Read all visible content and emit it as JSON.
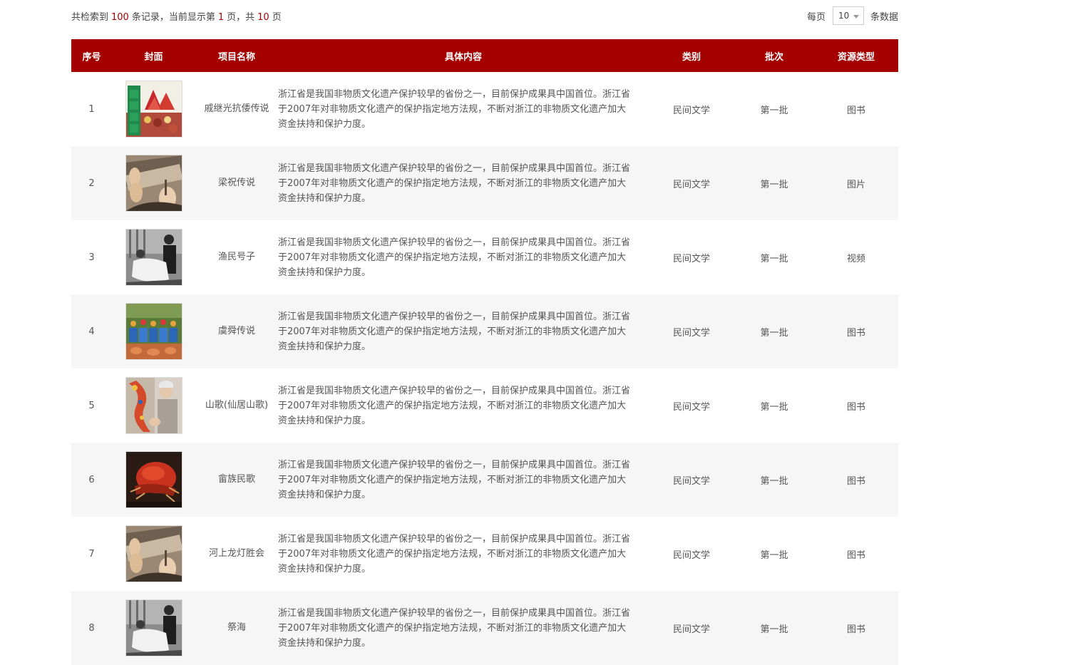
{
  "summary": {
    "prefix": "共检索到",
    "total": "100",
    "mid": "条记录，当前显示第",
    "page": "1",
    "mid2": "页，共",
    "pages": "10",
    "suffix": "页"
  },
  "pager": {
    "per_label": "每页",
    "per_value": "10",
    "per_suffix": "条数据"
  },
  "table": {
    "headers": [
      "序号",
      "封面",
      "项目名称",
      "具体内容",
      "类别",
      "批次",
      "资源类型"
    ],
    "rows": [
      {
        "no": "1",
        "cover": "festival-book-cover-image",
        "name": "戚继光抗倭传说",
        "desc": "浙江省是我国非物质文化遗产保护较早的省份之一，目前保护成果具中国首位。浙江省于2007年对非物质文化遗产的保护指定地方法规，不断对浙江的非物质文化遗产加大资金扶持和保护力度。",
        "category": "民间文学",
        "batch": "第一批",
        "type": "图书"
      },
      {
        "no": "2",
        "cover": "craft-hands-image",
        "name": "梁祝传说",
        "desc": "浙江省是我国非物质文化遗产保护较早的省份之一，目前保护成果具中国首位。浙江省于2007年对非物质文化遗产的保护指定地方法规，不断对浙江的非物质文化遗产加大资金扶持和保护力度。",
        "category": "民间文学",
        "batch": "第一批",
        "type": "图片"
      },
      {
        "no": "3",
        "cover": "bw-performers-image",
        "name": "渔民号子",
        "desc": "浙江省是我国非物质文化遗产保护较早的省份之一，目前保护成果具中国首位。浙江省于2007年对非物质文化遗产的保护指定地方法规，不断对浙江的非物质文化遗产加大资金扶持和保护力度。",
        "category": "民间文学",
        "batch": "第一批",
        "type": "视频"
      },
      {
        "no": "4",
        "cover": "folk-dance-crowd-image",
        "name": "虞舜传说",
        "desc": "浙江省是我国非物质文化遗产保护较早的省份之一，目前保护成果具中国首位。浙江省于2007年对非物质文化遗产的保护指定地方法规，不断对浙江的非物质文化遗产加大资金扶持和保护力度。",
        "category": "民间文学",
        "batch": "第一批",
        "type": "图书"
      },
      {
        "no": "5",
        "cover": "dragon-lantern-maker-image",
        "name": "山歌(仙居山歌)",
        "desc": "浙江省是我国非物质文化遗产保护较早的省份之一，目前保护成果具中国首位。浙江省于2007年对非物质文化遗产的保护指定地方法规，不断对浙江的非物质文化遗产加大资金扶持和保护力度。",
        "category": "民间文学",
        "batch": "第一批",
        "type": "图书"
      },
      {
        "no": "6",
        "cover": "red-carving-image",
        "name": "畲族民歌",
        "desc": "浙江省是我国非物质文化遗产保护较早的省份之一，目前保护成果具中国首位。浙江省于2007年对非物质文化遗产的保护指定地方法规，不断对浙江的非物质文化遗产加大资金扶持和保护力度。",
        "category": "民间文学",
        "batch": "第一批",
        "type": "图书"
      },
      {
        "no": "7",
        "cover": "craft-hands-image",
        "name": "河上龙灯胜会",
        "desc": "浙江省是我国非物质文化遗产保护较早的省份之一，目前保护成果具中国首位。浙江省于2007年对非物质文化遗产的保护指定地方法规，不断对浙江的非物质文化遗产加大资金扶持和保护力度。",
        "category": "民间文学",
        "batch": "第一批",
        "type": "图书"
      },
      {
        "no": "8",
        "cover": "bw-performers-image",
        "name": "祭海",
        "desc": "浙江省是我国非物质文化遗产保护较早的省份之一，目前保护成果具中国首位。浙江省于2007年对非物质文化遗产的保护指定地方法规，不断对浙江的非物质文化遗产加大资金扶持和保护力度。",
        "category": "民间文学",
        "batch": "第一批",
        "type": "图书"
      }
    ]
  },
  "colors": {
    "header_bg": "#a40000",
    "accent_num": "#a80000",
    "row_alt": "#f6f6f6"
  }
}
